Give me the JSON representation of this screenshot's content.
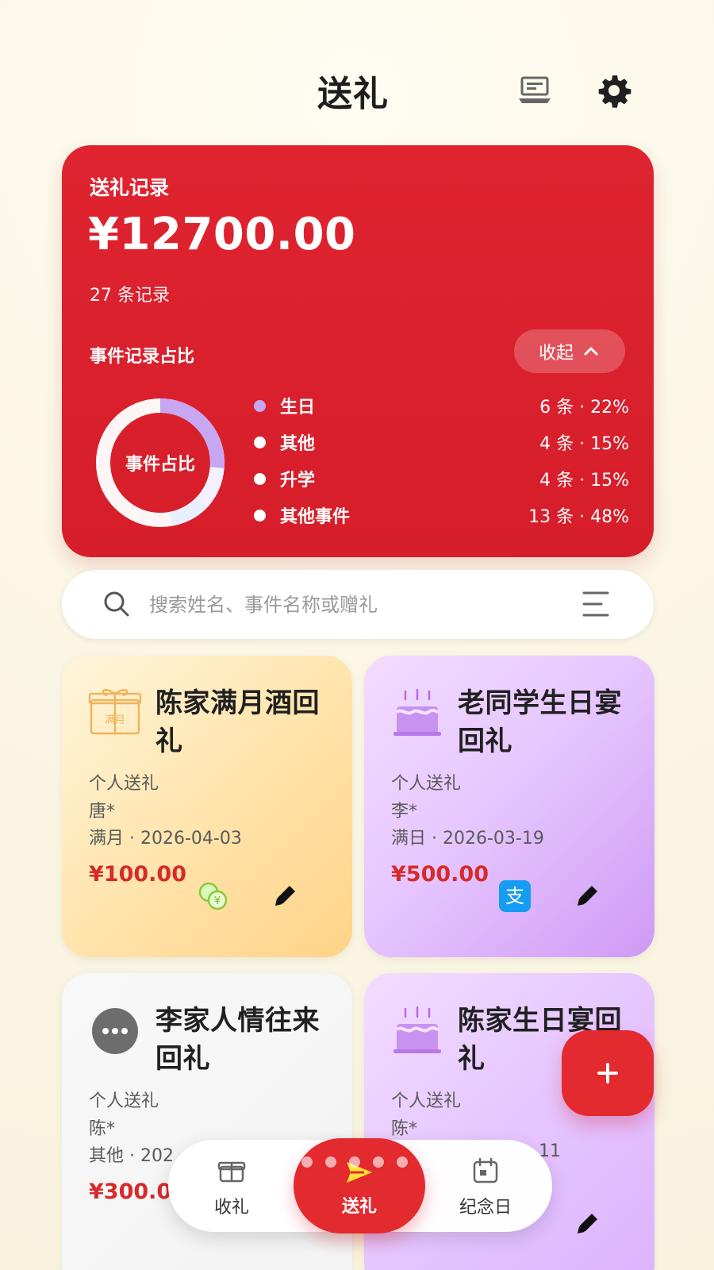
{
  "header": {
    "title": "送礼"
  },
  "summary": {
    "title": "送礼记录",
    "amount": "¥12700.00",
    "count": "27 条记录",
    "ratio_label": "事件记录占比",
    "collapse_label": "收起",
    "donut_center": "事件占比",
    "items": [
      {
        "name": "生日",
        "value": "6 条 · 22%",
        "color": "#c8a7f2"
      },
      {
        "name": "其他",
        "value": "4 条 · 15%",
        "color": "#ffffff"
      },
      {
        "name": "升学",
        "value": "4 条 · 15%",
        "color": "#ffffff"
      },
      {
        "name": "其他事件",
        "value": "13 条 · 48%",
        "color": "#ffffff"
      }
    ]
  },
  "search": {
    "placeholder": "搜索姓名、事件名称或赠礼"
  },
  "cards": [
    {
      "title": "陈家满月酒回礼",
      "type": "个人送礼",
      "person": "唐*",
      "date": "满月 · 2026-04-03",
      "amount": "¥100.00",
      "badge": "满月"
    },
    {
      "title": "老同学生日宴回礼",
      "type": "个人送礼",
      "person": "李*",
      "date": "满日 · 2026-03-19",
      "amount": "¥500.00"
    },
    {
      "title": "李家人情往来回礼",
      "type": "个人送礼",
      "person": "陈*",
      "date": "其他 · 202",
      "amount": "¥300.0"
    },
    {
      "title": "陈家生日宴回礼",
      "type": "个人送礼",
      "person": "陈*",
      "date": "11"
    }
  ],
  "nav": {
    "left_label": "收礼",
    "active_label": "送礼",
    "right_label": "纪念日"
  },
  "colors": {
    "brand_red": "#df2430",
    "background": "#fbf7e7",
    "card_orange": "#ffe7b4",
    "card_purple": "#e7c7ff",
    "card_gray": "#f3f3f3"
  }
}
